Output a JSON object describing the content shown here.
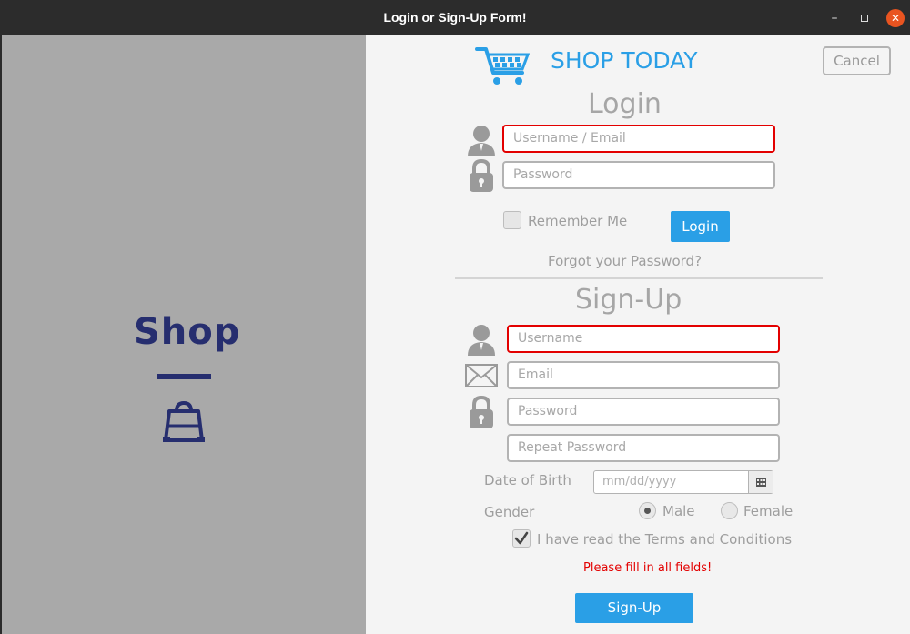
{
  "window": {
    "title": "Login or Sign-Up Form!",
    "close_glyph": "✕",
    "minimize_glyph": "–"
  },
  "left_panel": {
    "logo_text": "Shop",
    "logo_color": "#262e6f",
    "background": "#a9a9a9"
  },
  "header": {
    "brand": "SHOP TODAY",
    "brand_color": "#2a9fe6",
    "cancel_label": "Cancel"
  },
  "login": {
    "heading": "Login",
    "username_placeholder": "Username / Email",
    "password_placeholder": "Password",
    "remember_label": "Remember Me",
    "remember_checked": false,
    "login_label": "Login",
    "forgot_label": "Forgot your Password?"
  },
  "signup": {
    "heading": "Sign-Up",
    "username_placeholder": "Username",
    "email_placeholder": "Email",
    "password_placeholder": "Password",
    "repeat_password_placeholder": "Repeat Password",
    "dob_label": "Date of Birth",
    "dob_placeholder": "mm/dd/yyyy",
    "gender_label": "Gender",
    "gender_options": [
      "Male",
      "Female"
    ],
    "gender_selected": "Male",
    "terms_label": "I have read the Terms and Conditions",
    "terms_checked": true,
    "error_message": "Please fill in all fields!",
    "signup_label": "Sign-Up"
  },
  "colors": {
    "accent": "#2a9fe6",
    "error": "#e30000",
    "titlebar_close": "#e95420"
  }
}
